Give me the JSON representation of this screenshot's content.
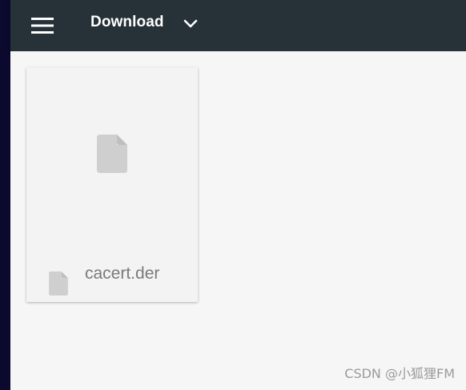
{
  "header": {
    "menu_icon": "hamburger-menu-icon",
    "location_label": "Download",
    "dropdown_icon": "chevron-down-icon"
  },
  "files": [
    {
      "name": "cacert.der",
      "thumbnail_icon": "file-icon",
      "type_icon": "file-icon"
    }
  ],
  "watermark": "CSDN @小狐狸FM",
  "colors": {
    "toolbar": "#263238",
    "background": "#f6f6f6",
    "card": "#f3f3f3",
    "icon_gray": "#cfcfcf",
    "file_name_text": "#7a7a7a"
  }
}
